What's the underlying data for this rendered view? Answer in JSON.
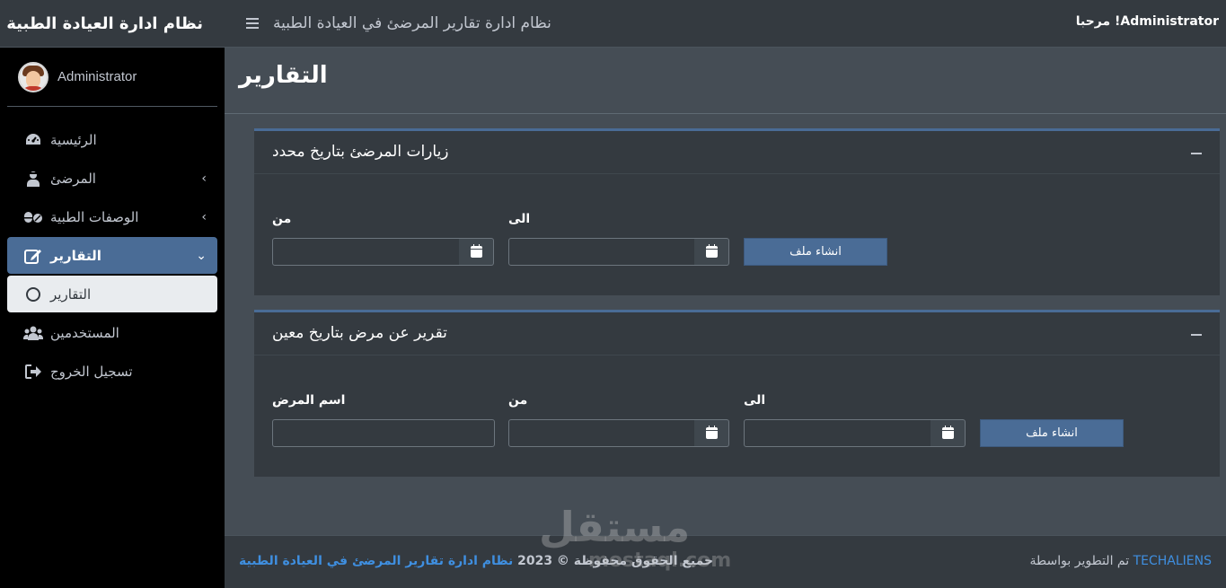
{
  "brand": {
    "title": "نظام ادارة العيادة الطبية"
  },
  "user": {
    "name": "Administrator"
  },
  "topbar": {
    "title": "نظام ادارة تقارير المرضئ في العيادة الطبية",
    "welcome": "Administrator! مرحبا"
  },
  "sidebar": {
    "items": [
      {
        "label": "الرئيسية",
        "icon": "dashboard-icon"
      },
      {
        "label": "المرضئ",
        "icon": "patient-icon"
      },
      {
        "label": "الوصفات الطبية",
        "icon": "pills-icon"
      },
      {
        "label": "التقارير",
        "icon": "edit-icon"
      },
      {
        "label": "التقارير",
        "icon": "circle-icon"
      },
      {
        "label": "المستخدمين",
        "icon": "users-icon"
      },
      {
        "label": "تسجيل الخروج",
        "icon": "sign-out-icon"
      }
    ]
  },
  "page": {
    "title": "التقارير"
  },
  "card1": {
    "title": "زيارات المرضئ بتاريخ محدد",
    "from_label": "من",
    "to_label": "الى",
    "button": "انشاء ملف"
  },
  "card2": {
    "title": "تقرير عن مرض بتاريخ معين",
    "name_label": "اسم المرض",
    "from_label": "من",
    "to_label": "الى",
    "button": "انشاء ملف"
  },
  "footer": {
    "rights": "حميع الحقوق محفوظة © 2023",
    "rights_link": "نظام ادارة تقارير المرضئ في العيادة الطبية",
    "dev_link": "TECHALIENS",
    "dev_text": "تم التطوير بواسطة"
  },
  "watermark": {
    "text": "مستقل",
    "sub": "mostaql.com"
  },
  "colors": {
    "accent": "#4a6c96",
    "sidebar": "#000000",
    "navbar": "#343a40",
    "content": "#454d55",
    "link": "#3f8fe0"
  }
}
